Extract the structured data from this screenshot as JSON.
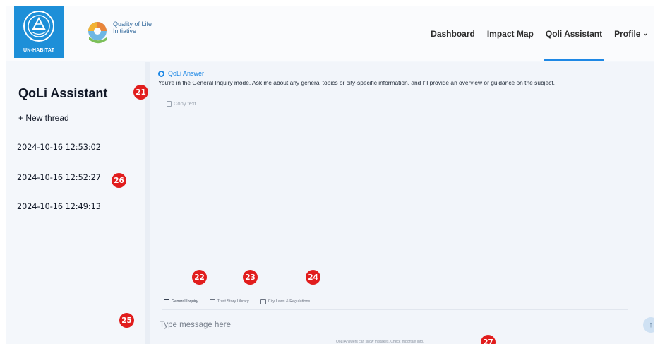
{
  "header": {
    "un_logo_text": "UN-HABITAT",
    "qoli_title_line1": "Quality of Life",
    "qoli_title_line2": "Initiative",
    "nav": [
      {
        "label": "Dashboard"
      },
      {
        "label": "Impact Map"
      },
      {
        "label": "Qoli Assistant",
        "active": true
      },
      {
        "label": "Profile"
      }
    ]
  },
  "sidebar": {
    "title": "QoLi Assistant",
    "new_thread": "+ New thread",
    "threads": [
      "2024-10-16 12:53:02",
      "2024-10-16 12:52:27",
      "2024-10-16 12:49:13"
    ]
  },
  "main": {
    "answer_label": "QoLi Answer",
    "answer_text": "You're in the General Inquiry mode. Ask me about any general topics or city-specific information, and I'll provide an overview or guidance on the subject.",
    "copy_label": "Copy text",
    "mode_tabs": [
      {
        "label": "General Inquiry",
        "icon": "chat-icon",
        "active": true
      },
      {
        "label": "Trust Story Library",
        "icon": "folder-icon"
      },
      {
        "label": "City Laws & Regulations",
        "icon": "scales-icon"
      }
    ],
    "input_placeholder": "Type message here",
    "send_icon": "arrow-up-icon",
    "disclaimer": "QoLi Answers can show mistakes. Check important info."
  },
  "callouts": [
    "21",
    "22",
    "23",
    "24",
    "25",
    "26",
    "27"
  ],
  "colors": {
    "accent": "#1e88e5",
    "un_blue": "#1d8fd8",
    "callout_red": "#e11d1d"
  }
}
